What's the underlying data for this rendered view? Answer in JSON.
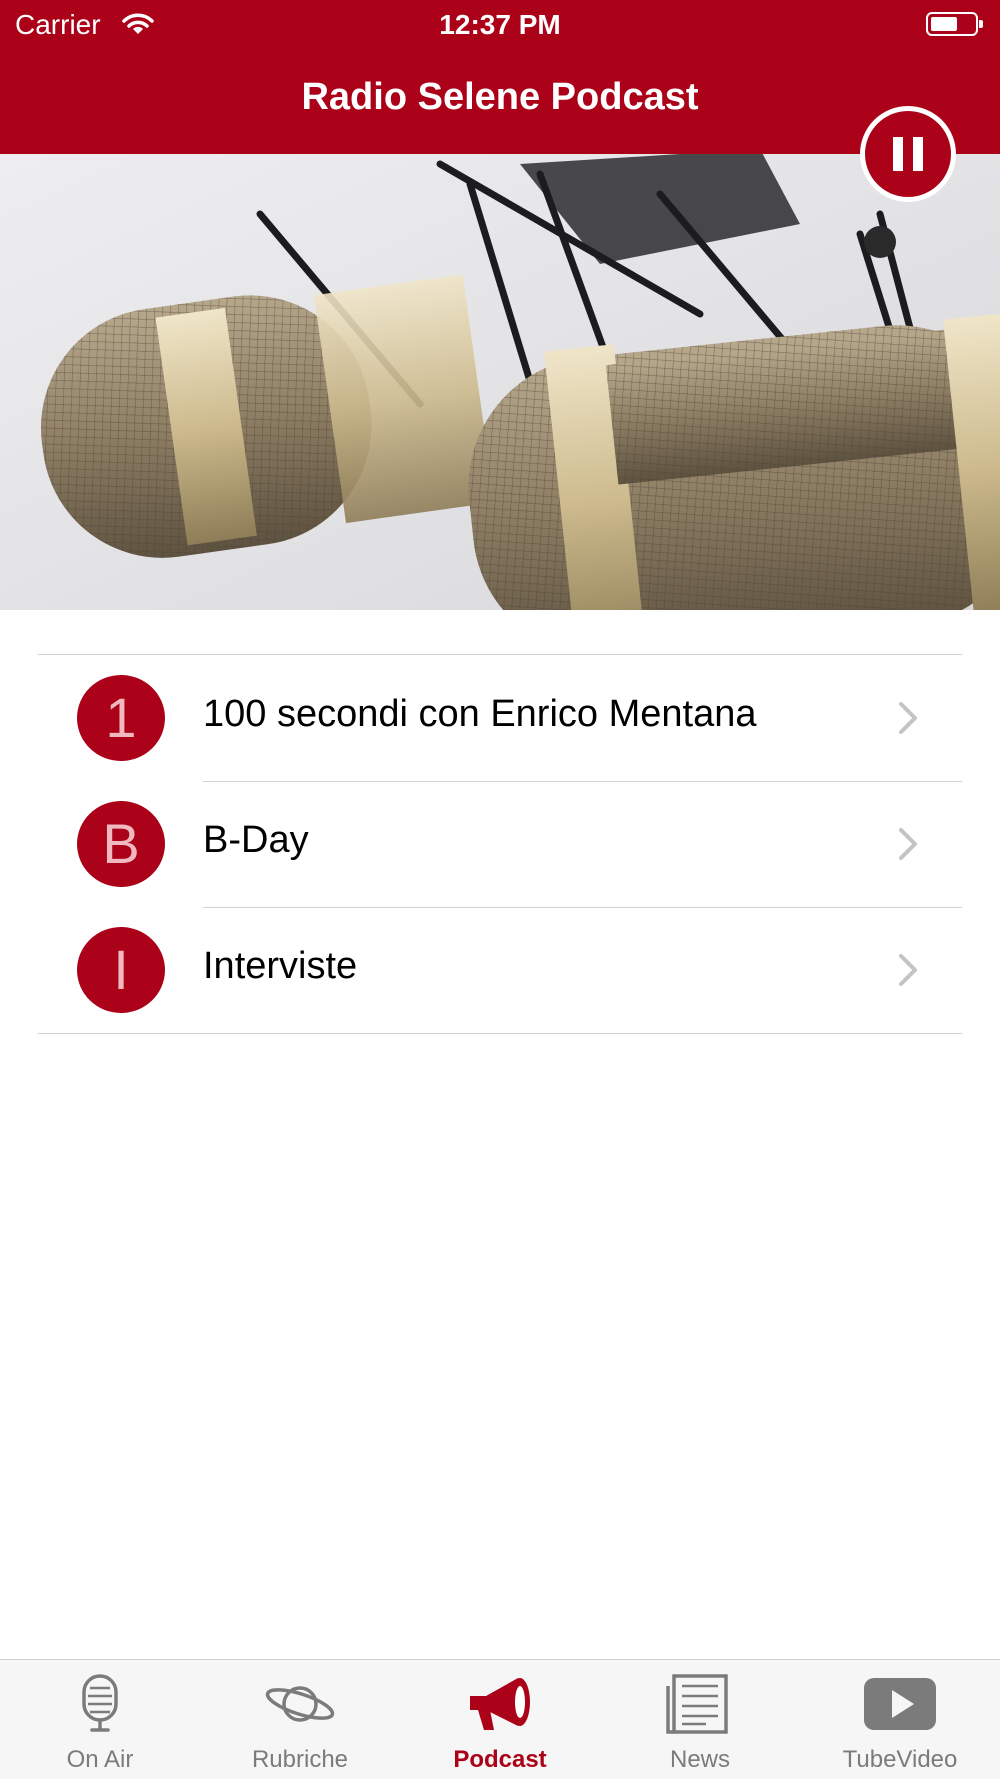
{
  "status_bar": {
    "carrier": "Carrier",
    "time": "12:37 PM"
  },
  "header": {
    "title": "Radio Selene Podcast"
  },
  "player": {
    "state": "playing",
    "button_icon": "pause-icon"
  },
  "podcasts": [
    {
      "badge": "1",
      "label": "100 secondi con Enrico Mentana"
    },
    {
      "badge": "B",
      "label": "B-Day"
    },
    {
      "badge": "I",
      "label": "Interviste"
    }
  ],
  "tabbar": {
    "active": "Podcast",
    "tabs": [
      {
        "label": "On Air",
        "icon": "microphone-icon"
      },
      {
        "label": "Rubriche",
        "icon": "planet-icon"
      },
      {
        "label": "Podcast",
        "icon": "megaphone-icon"
      },
      {
        "label": "News",
        "icon": "newspaper-icon"
      },
      {
        "label": "TubeVideo",
        "icon": "play-video-icon"
      }
    ]
  },
  "colors": {
    "brand": "#ab0219",
    "badge_text": "#f0b8c0",
    "tab_inactive": "#7b7b7b"
  }
}
